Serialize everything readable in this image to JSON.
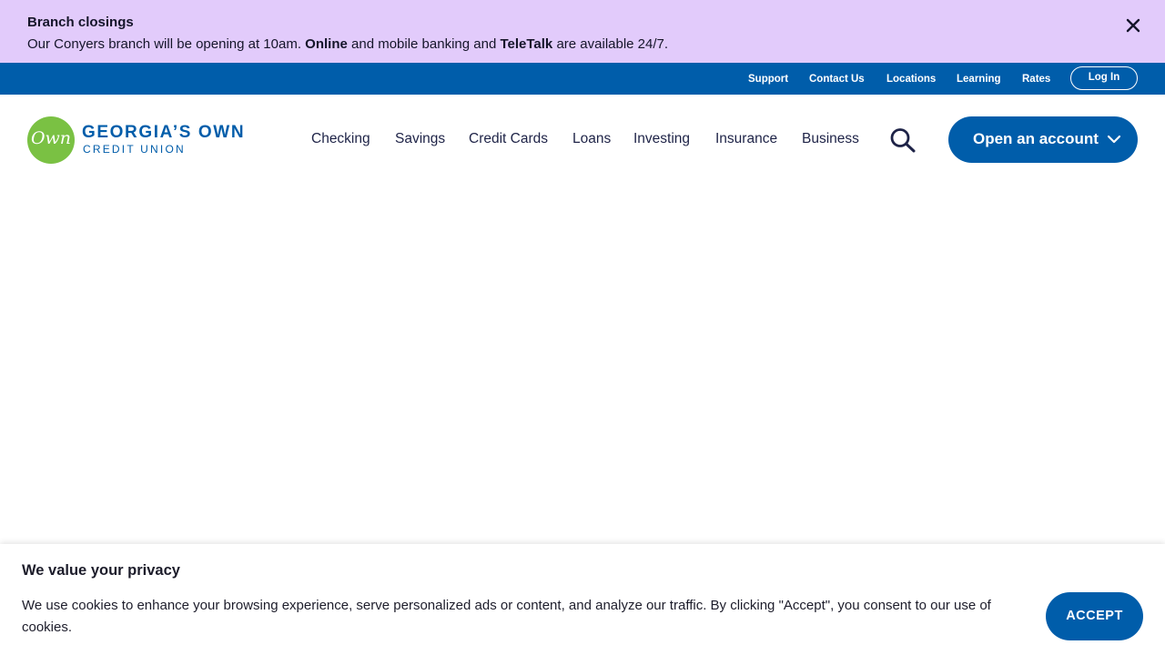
{
  "alert": {
    "title": "Branch closings",
    "message_part1": "Our Conyers branch will be opening at 10am. ",
    "link_online": "Online",
    "message_part2": " and mobile banking and ",
    "link_teletalk": "TeleTalk",
    "message_part3": " are available 24/7.",
    "close_icon": "close-icon",
    "bg_color": "#e2cbfb"
  },
  "utility_nav": {
    "support": "Support",
    "contact_us": "Contact Us",
    "locations": "Locations",
    "learning": "Learning",
    "rates": "Rates",
    "login": "Log In",
    "bg_color": "#005daa"
  },
  "logo": {
    "mark": "Own",
    "line1": "GEORGIA’S OWN",
    "line2": "CREDIT UNION"
  },
  "main_nav": {
    "items": [
      "Checking",
      "Savings",
      "Credit Cards",
      "Loans",
      "Investing",
      "Insurance",
      "Business"
    ],
    "search_icon": "search-icon",
    "open_account": "Open an account",
    "open_account_icon": "chevron-down-icon"
  },
  "cookie_banner": {
    "title": "We value your privacy",
    "text": "We use cookies to enhance your browsing experience, serve personalized ads or content, and analyze our traffic. By clicking \"Accept\", you consent to our use of cookies.",
    "accept": "ACCEPT"
  },
  "colors": {
    "brand_blue": "#005daa",
    "brand_green": "#7ac143",
    "nav_text": "#1e2347"
  }
}
